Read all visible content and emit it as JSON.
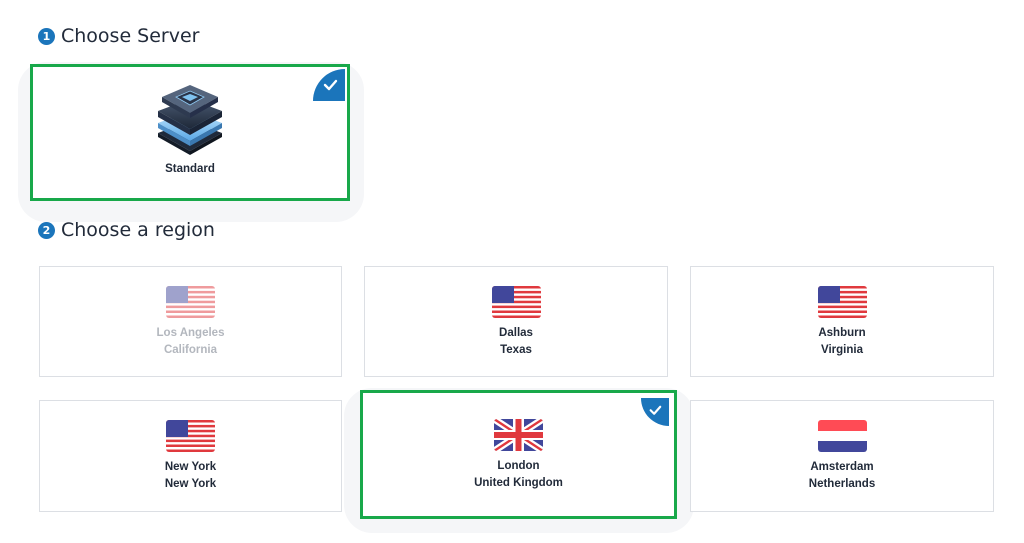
{
  "steps": {
    "server": {
      "number": "1",
      "title": "Choose Server"
    },
    "region": {
      "number": "2",
      "title": "Choose a region"
    }
  },
  "server_options": [
    {
      "label": "Standard",
      "selected": true,
      "icon": "server-chip-icon"
    }
  ],
  "regions": [
    {
      "city": "Los Angeles",
      "area": "California",
      "flag": "us-flag-icon",
      "disabled": true,
      "selected": false
    },
    {
      "city": "Dallas",
      "area": "Texas",
      "flag": "us-flag-icon",
      "disabled": false,
      "selected": false
    },
    {
      "city": "Ashburn",
      "area": "Virginia",
      "flag": "us-flag-icon",
      "disabled": false,
      "selected": false
    },
    {
      "city": "New York",
      "area": "New York",
      "flag": "us-flag-icon",
      "disabled": false,
      "selected": false
    },
    {
      "city": "London",
      "area": "United Kingdom",
      "flag": "uk-flag-icon",
      "disabled": false,
      "selected": true
    },
    {
      "city": "Amsterdam",
      "area": "Netherlands",
      "flag": "nl-flag-icon",
      "disabled": false,
      "selected": false
    }
  ],
  "colors": {
    "accent_blue": "#1b75bb",
    "selection_green": "#18a84a",
    "text_dark": "#222b3a",
    "text_disabled": "#b3b7be"
  }
}
